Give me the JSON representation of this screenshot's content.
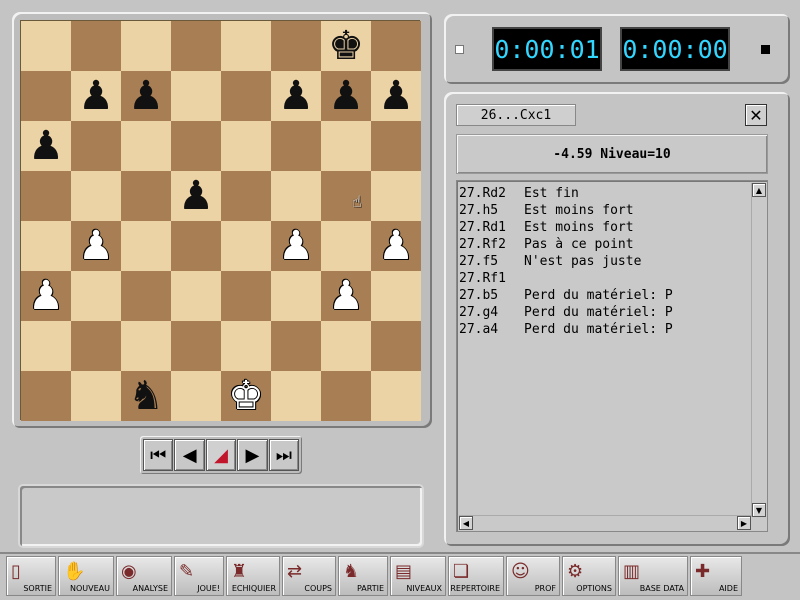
{
  "board": {
    "rows": [
      [
        "",
        "",
        "",
        "",
        "",
        "",
        "bk",
        ""
      ],
      [
        "",
        "bp",
        "bp",
        "",
        "",
        "bp",
        "bp",
        "bp"
      ],
      [
        "bp",
        "",
        "",
        "",
        "",
        "",
        "",
        ""
      ],
      [
        "",
        "",
        "",
        "bp",
        "",
        "",
        "",
        ""
      ],
      [
        "",
        "wp",
        "",
        "",
        "",
        "wp",
        "",
        "wp"
      ],
      [
        "wp",
        "",
        "",
        "",
        "",
        "",
        "wp",
        ""
      ],
      [
        "",
        "",
        "",
        "",
        "",
        "",
        "",
        ""
      ],
      [
        "",
        "",
        "bn",
        "",
        "wk",
        "",
        "",
        ""
      ]
    ],
    "light_color": "#ecd3a6",
    "dark_color": "#a87f55"
  },
  "nav": {
    "buttons": [
      "first-move",
      "previous-move",
      "take-back",
      "next-move",
      "last-move"
    ]
  },
  "clocks": {
    "white_time": "0:00:01",
    "black_time": "0:00:00",
    "digit_color": "#33d6ff"
  },
  "analysis": {
    "last_move": "26...Cxc1",
    "eval_line": "-4.59 Niveau=10",
    "moves": [
      {
        "move": "27.Rd2",
        "comment": "Est fin"
      },
      {
        "move": "27.h5",
        "comment": "Est moins fort"
      },
      {
        "move": "27.Rd1",
        "comment": "Est moins fort"
      },
      {
        "move": "27.Rf2",
        "comment": "Pas à ce point"
      },
      {
        "move": "27.f5",
        "comment": "N'est pas juste"
      },
      {
        "move": "27.Rf1",
        "comment": ""
      },
      {
        "move": "27.b5",
        "comment": "Perd du matériel: P"
      },
      {
        "move": "27.g4",
        "comment": "Perd du matériel: P"
      },
      {
        "move": "27.a4",
        "comment": "Perd du matériel: P"
      }
    ]
  },
  "toolbar": [
    {
      "label": "SORTIE",
      "icon": "door-icon"
    },
    {
      "label": "NOUVEAU",
      "icon": "hand-icon"
    },
    {
      "label": "ANALYSE",
      "icon": "eye-icon"
    },
    {
      "label": "JOUE!",
      "icon": "move-icon"
    },
    {
      "label": "ECHIQUIER",
      "icon": "board-icon"
    },
    {
      "label": "COUPS",
      "icon": "moves-icon"
    },
    {
      "label": "PARTIE",
      "icon": "game-icon"
    },
    {
      "label": "NIVEAUX",
      "icon": "levels-icon"
    },
    {
      "label": "REPERTOIRE",
      "icon": "book-icon"
    },
    {
      "label": "PROF",
      "icon": "teacher-icon"
    },
    {
      "label": "OPTIONS",
      "icon": "tools-icon"
    },
    {
      "label": "BASE DATA",
      "icon": "database-icon"
    },
    {
      "label": "AIDE",
      "icon": "help-icon"
    }
  ]
}
